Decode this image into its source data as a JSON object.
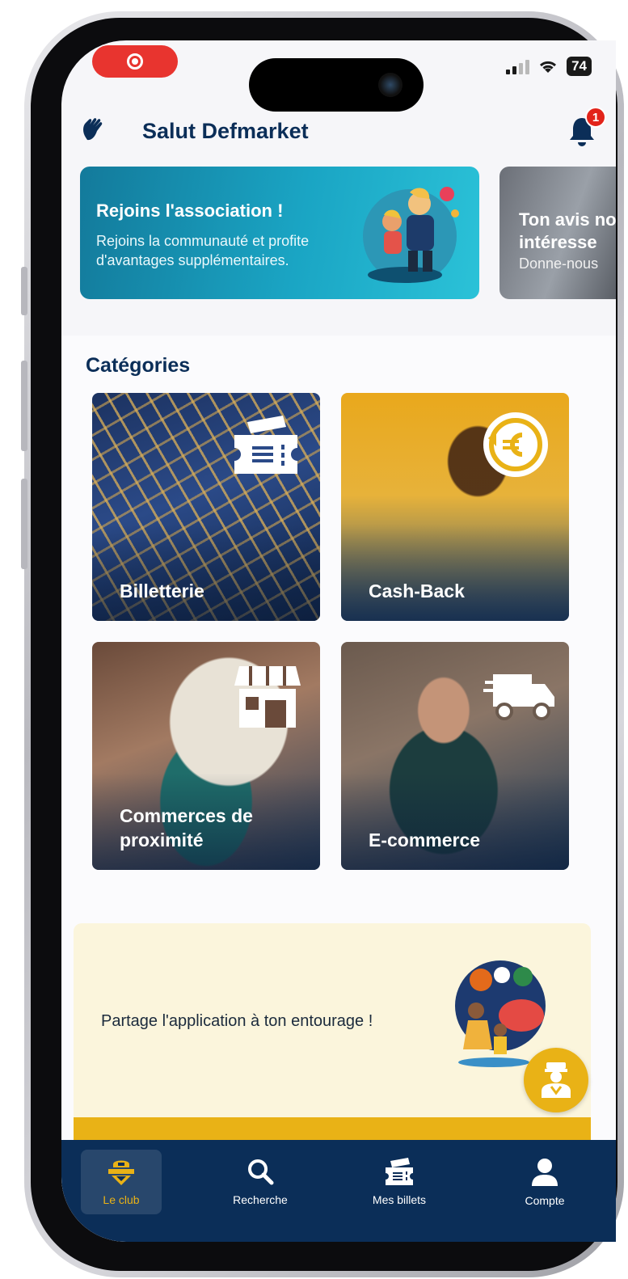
{
  "status_bar": {
    "battery": "74"
  },
  "header": {
    "greeting": "Salut Defmarket",
    "notification_count": "1"
  },
  "banners": [
    {
      "title": "Rejoins l'association !",
      "text": "Rejoins la communauté et profite d'avantages supplémentaires."
    },
    {
      "title": "Ton avis nous intéresse",
      "text": "Donne-nous"
    }
  ],
  "categories": {
    "title": "Catégories",
    "items": [
      {
        "label": "Billetterie",
        "icon": "ticket-icon"
      },
      {
        "label": "Cash-Back",
        "icon": "euro-cashback-icon"
      },
      {
        "label": "Commerces de proximité",
        "icon": "storefront-icon"
      },
      {
        "label": "E-commerce",
        "icon": "delivery-truck-icon"
      }
    ]
  },
  "share": {
    "text": "Partage l'application à ton entourage !"
  },
  "tabs": [
    {
      "label": "Le club",
      "icon": "club-shield-icon",
      "active": true
    },
    {
      "label": "Recherche",
      "icon": "search-icon",
      "active": false
    },
    {
      "label": "Mes billets",
      "icon": "tickets-icon",
      "active": false
    },
    {
      "label": "Compte",
      "icon": "user-icon",
      "active": false
    }
  ],
  "colors": {
    "primary": "#0b2e58",
    "accent": "#e9b216",
    "banner": "#1aa5c4",
    "badge": "#e2231a"
  }
}
